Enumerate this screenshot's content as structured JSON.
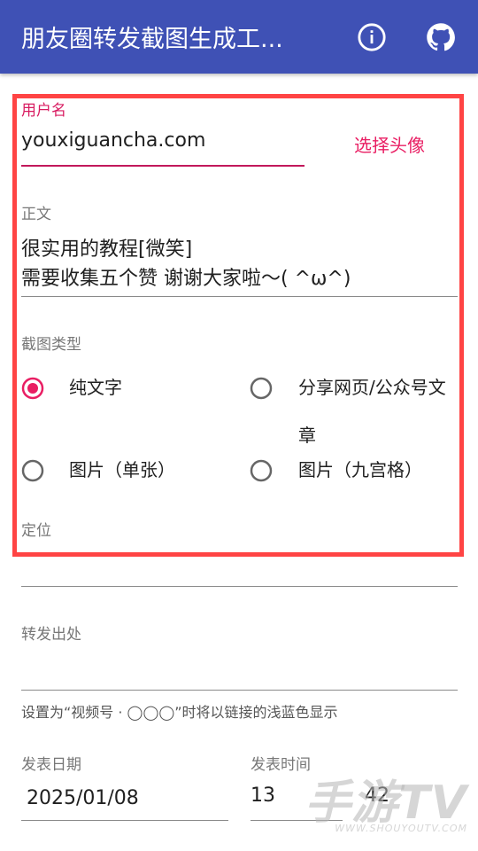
{
  "appbar": {
    "title": "朋友圈转发截图生成工...",
    "info_icon": "info-icon",
    "github_icon": "github-icon"
  },
  "username": {
    "label": "用户名",
    "value": "youxiguancha.com",
    "choose_avatar": "选择头像"
  },
  "body": {
    "label": "正文",
    "line1": "很实用的教程[微笑]",
    "line2": "需要收集五个赞 谢谢大家啦～(    ^ω^)"
  },
  "screenshot_type": {
    "label": "截图类型",
    "options": [
      {
        "label": "纯文字",
        "selected": true
      },
      {
        "label": "分享网页/公众号文",
        "label2": "章",
        "selected": false
      },
      {
        "label": "图片（单张）",
        "selected": false
      },
      {
        "label": "图片（九宫格）",
        "selected": false
      }
    ]
  },
  "location": {
    "label": "定位",
    "value": ""
  },
  "forward_source": {
    "label": "转发出处",
    "value": "",
    "hint": "设置为“视频号 · ◯◯◯”时将以链接的浅蓝色显示"
  },
  "publish_date": {
    "label": "发表日期",
    "value": "2025/01/08"
  },
  "publish_time": {
    "label": "发表时间",
    "hour": "13",
    "minute": "42"
  },
  "watermark": {
    "main": "手游TV",
    "sub": "WWW.SHOUYOUTV.COM"
  },
  "colors": {
    "primary": "#3f51b5",
    "accent": "#e91e63",
    "highlight_border": "#ff4444"
  }
}
